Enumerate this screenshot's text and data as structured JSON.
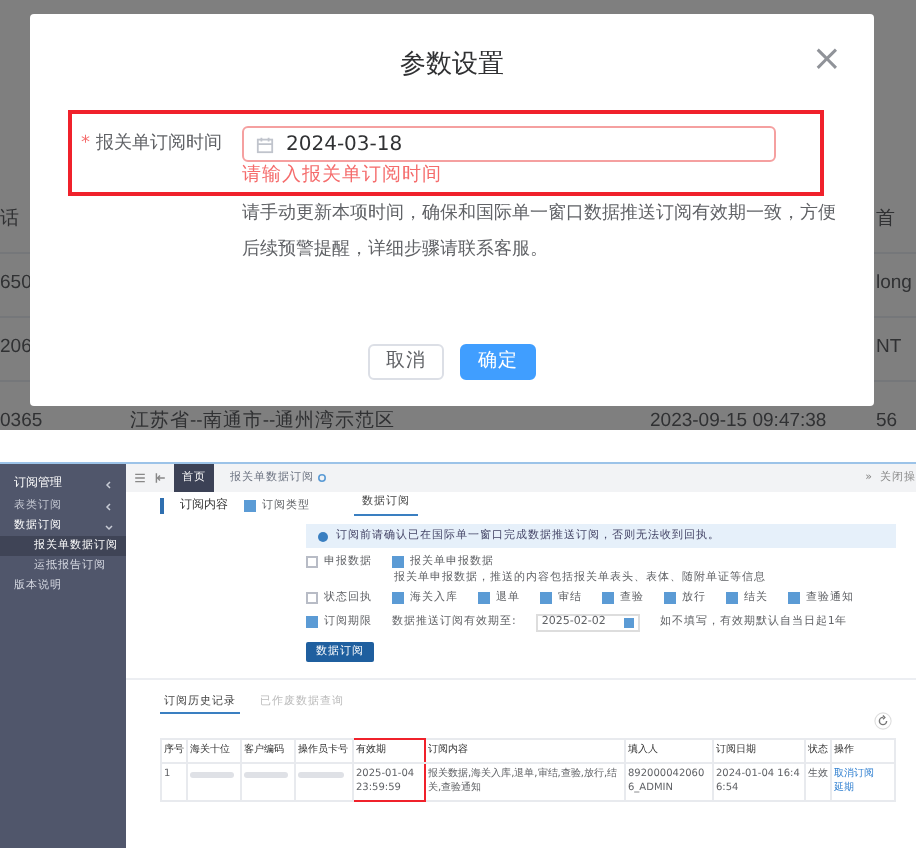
{
  "background_table": {
    "rows": [
      {
        "column_1": "话",
        "column_4": "首"
      },
      {
        "column_1": "650",
        "column_4": "long"
      },
      {
        "column_1": "206",
        "column_4": "NT"
      },
      {
        "column_1": "0365",
        "column_2": "江苏省--南通市--通州湾示范区",
        "column_3": "2023-09-15 09:47:38",
        "column_4": "56"
      }
    ]
  },
  "dialog": {
    "title": "参数设置",
    "close": "×",
    "field": {
      "required_mark": "*",
      "label": "报关单订阅时间",
      "value": "2024-03-18",
      "error": "请输入报关单订阅时间",
      "highlighted": true
    },
    "hint": "请手动更新本项时间，确保和国际单一窗口数据推送订阅有效期一致，方便后续预警提醒，详细步骤请联系客服。",
    "buttons": [
      {
        "label": "取消",
        "kind": "secondary"
      },
      {
        "label": "确定",
        "kind": "primary"
      }
    ]
  },
  "app": {
    "sidebar": {
      "title": "订阅管理",
      "items": [
        {
          "label": "表类订阅",
          "kind": "group",
          "expanded": false
        },
        {
          "label": "数据订阅",
          "kind": "group",
          "expanded": true,
          "children": [
            {
              "label": "报关单数据订阅",
              "selected": true
            },
            {
              "label": "运抵报告订阅",
              "selected": false
            }
          ]
        },
        {
          "label": "版本说明",
          "kind": "link"
        }
      ]
    },
    "tabs": [
      {
        "label": "首页",
        "selected": true,
        "closable": false
      },
      {
        "label": "报关单数据订阅",
        "selected": false,
        "closable": true
      }
    ],
    "tab_bar_more": "»",
    "tab_bar_action": "关闭操",
    "section_title": "订阅内容",
    "type_option": {
      "label": "订阅类型",
      "checked": true
    },
    "sub_tabs": [
      {
        "label": "数据订阅",
        "selected": true
      }
    ],
    "alert": "订阅前请确认已在国际单一窗口完成数据推送订阅，否则无法收到回执。",
    "option_rows": [
      {
        "main": {
          "label": "申报数据",
          "checked": false
        },
        "options": [
          {
            "label": "报关单申报数据",
            "checked": true
          }
        ],
        "note": "报关单申报数据，推送的内容包括报关单表头、表体、随附单证等信息"
      },
      {
        "main": {
          "label": "状态回执",
          "checked": false
        },
        "options": [
          {
            "label": "海关入库",
            "checked": true
          },
          {
            "label": "退单",
            "checked": true
          },
          {
            "label": "审结",
            "checked": true
          },
          {
            "label": "查验",
            "checked": true
          },
          {
            "label": "放行",
            "checked": true
          },
          {
            "label": "结关",
            "checked": true
          },
          {
            "label": "查验通知",
            "checked": true
          }
        ]
      },
      {
        "main": {
          "label": "订阅期限",
          "checked": true
        },
        "date_label": "数据推送订阅有效期至:",
        "date_value": "2025-02-02",
        "date_note": "如不填写，有效期默认自当日起1年"
      }
    ],
    "submit": "数据订阅",
    "history_tabs": [
      {
        "label": "订阅历史记录",
        "selected": true
      },
      {
        "label": "已作废数据查询",
        "selected": false
      }
    ],
    "table": {
      "columns": [
        {
          "label": "序号",
          "highlighted": false
        },
        {
          "label": "海关十位",
          "highlighted": false
        },
        {
          "label": "客户编码",
          "highlighted": false
        },
        {
          "label": "操作员卡号",
          "highlighted": false
        },
        {
          "label": "有效期",
          "highlighted": true
        },
        {
          "label": "订阅内容",
          "highlighted": false
        },
        {
          "label": "填入人",
          "highlighted": false
        },
        {
          "label": "订阅日期",
          "highlighted": false
        },
        {
          "label": "状态",
          "highlighted": false
        },
        {
          "label": "操作",
          "highlighted": false
        }
      ],
      "rows": [
        {
          "cells": [
            {
              "kind": "text",
              "text": "1"
            },
            {
              "kind": "blurred"
            },
            {
              "kind": "blurred"
            },
            {
              "kind": "blurred"
            },
            {
              "kind": "text",
              "text": "2025-01-04 23:59:59"
            },
            {
              "kind": "text",
              "text": "报关数据,海关入库,退单,审结,查验,放行,结关,查验通知"
            },
            {
              "kind": "text",
              "text": "8920000420606_ADMIN"
            },
            {
              "kind": "text",
              "text": "2024-01-04 16:46:54"
            },
            {
              "kind": "text",
              "text": "生效"
            },
            {
              "kind": "actions",
              "actions": [
                "取消订阅",
                "延期"
              ]
            }
          ]
        }
      ]
    }
  }
}
